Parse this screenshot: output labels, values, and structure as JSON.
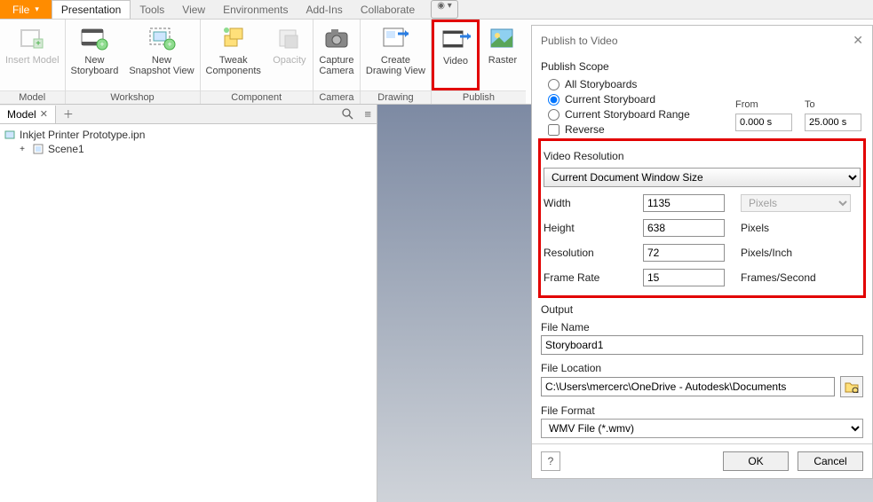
{
  "menubar": {
    "file": "File",
    "items": [
      "Presentation",
      "Tools",
      "View",
      "Environments",
      "Add-Ins",
      "Collaborate"
    ],
    "active_index": 0
  },
  "ribbon": {
    "groups": [
      {
        "label": "Model",
        "buttons": [
          {
            "label": "Insert Model",
            "icon": "insert-model",
            "disabled": true
          }
        ]
      },
      {
        "label": "Workshop",
        "buttons": [
          {
            "label": "New\nStoryboard",
            "icon": "storyboard"
          },
          {
            "label": "New\nSnapshot View",
            "icon": "snapshot"
          }
        ]
      },
      {
        "label": "Component",
        "buttons": [
          {
            "label": "Tweak\nComponents",
            "icon": "tweak"
          },
          {
            "label": "Opacity",
            "icon": "opacity",
            "disabled": true
          }
        ]
      },
      {
        "label": "Camera",
        "buttons": [
          {
            "label": "Capture\nCamera",
            "icon": "camera"
          }
        ]
      },
      {
        "label": "Drawing",
        "buttons": [
          {
            "label": "Create\nDrawing View",
            "icon": "drawing"
          }
        ]
      },
      {
        "label": "Publish",
        "buttons": [
          {
            "label": "Video",
            "icon": "video",
            "highlight": true
          },
          {
            "label": "Raster",
            "icon": "raster"
          }
        ]
      }
    ]
  },
  "browser": {
    "tab_label": "Model",
    "root": "Inkjet Printer Prototype.ipn",
    "child": "Scene1"
  },
  "dialog": {
    "title": "Publish to Video",
    "publish_scope": {
      "header": "Publish Scope",
      "opts": [
        "All Storyboards",
        "Current Storyboard",
        "Current Storyboard Range"
      ],
      "selected": 1,
      "reverse_label": "Reverse",
      "from_label": "From",
      "from_value": "0.000 s",
      "to_label": "To",
      "to_value": "25.000 s"
    },
    "video_res": {
      "header": "Video Resolution",
      "preset": "Current Document Window Size",
      "rows": [
        {
          "label": "Width",
          "value": "1135",
          "unit_type": "select",
          "unit": "Pixels"
        },
        {
          "label": "Height",
          "value": "638",
          "unit_type": "text",
          "unit": "Pixels"
        },
        {
          "label": "Resolution",
          "value": "72",
          "unit_type": "text",
          "unit": "Pixels/Inch"
        },
        {
          "label": "Frame Rate",
          "value": "15",
          "unit_type": "text",
          "unit": "Frames/Second"
        }
      ]
    },
    "output": {
      "header": "Output",
      "filename_label": "File Name",
      "filename": "Storyboard1",
      "location_label": "File Location",
      "location": "C:\\Users\\mercerc\\OneDrive - Autodesk\\Documents",
      "format_label": "File Format",
      "format": "WMV File (*.wmv)"
    },
    "buttons": {
      "ok": "OK",
      "cancel": "Cancel"
    }
  }
}
